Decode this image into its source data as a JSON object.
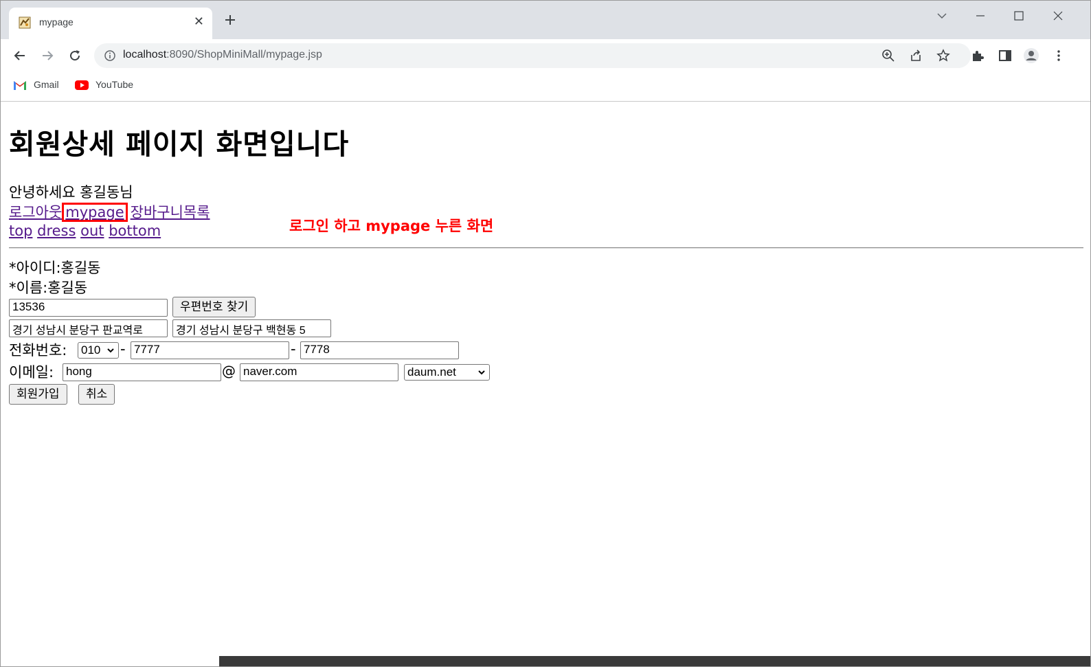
{
  "browser": {
    "tab_title": "mypage",
    "url_host": "localhost",
    "url_rest": ":8090/ShopMiniMall/mypage.jsp",
    "bookmarks": [
      {
        "label": "Gmail",
        "icon": "gmail-icon"
      },
      {
        "label": "YouTube",
        "icon": "youtube-icon"
      }
    ]
  },
  "page": {
    "heading": "회원상세 페이지 화면입니다",
    "greeting": "안녕하세요 홍길동님",
    "links_row1": {
      "logout": "로그아웃",
      "mypage": "mypage",
      "cart": "장바구니목록"
    },
    "links_row2": {
      "top": "top",
      "dress": "dress",
      "out": "out",
      "bottom": "bottom"
    },
    "annotation": "로그인 하고 mypage 누른 화면",
    "user_id_line": "*아이디:홍길동",
    "user_name_line": "*이름:홍길동",
    "postcode": "13536",
    "find_postcode_label": "우편번호 찾기",
    "address1": "경기 성남시 분당구 판교역로",
    "address2": "경기 성남시 분당구 백현동 5",
    "phone_label": "전화번호:",
    "phone1_selected": "010",
    "phone_sep1": "-",
    "phone2": "7777",
    "phone_sep2": "-",
    "phone3": "7778",
    "email_label": "이메일:",
    "email_id": "hong",
    "email_at": "@",
    "email_domain": "naver.com",
    "email_domain_select": "daum.net",
    "submit_label": "회원가입",
    "cancel_label": "취소"
  },
  "colors": {
    "link_visited": "#551a8b",
    "annotation_red": "#ff0000",
    "tabstrip_bg": "#dee1e6",
    "omnibox_bg": "#f1f3f4"
  }
}
